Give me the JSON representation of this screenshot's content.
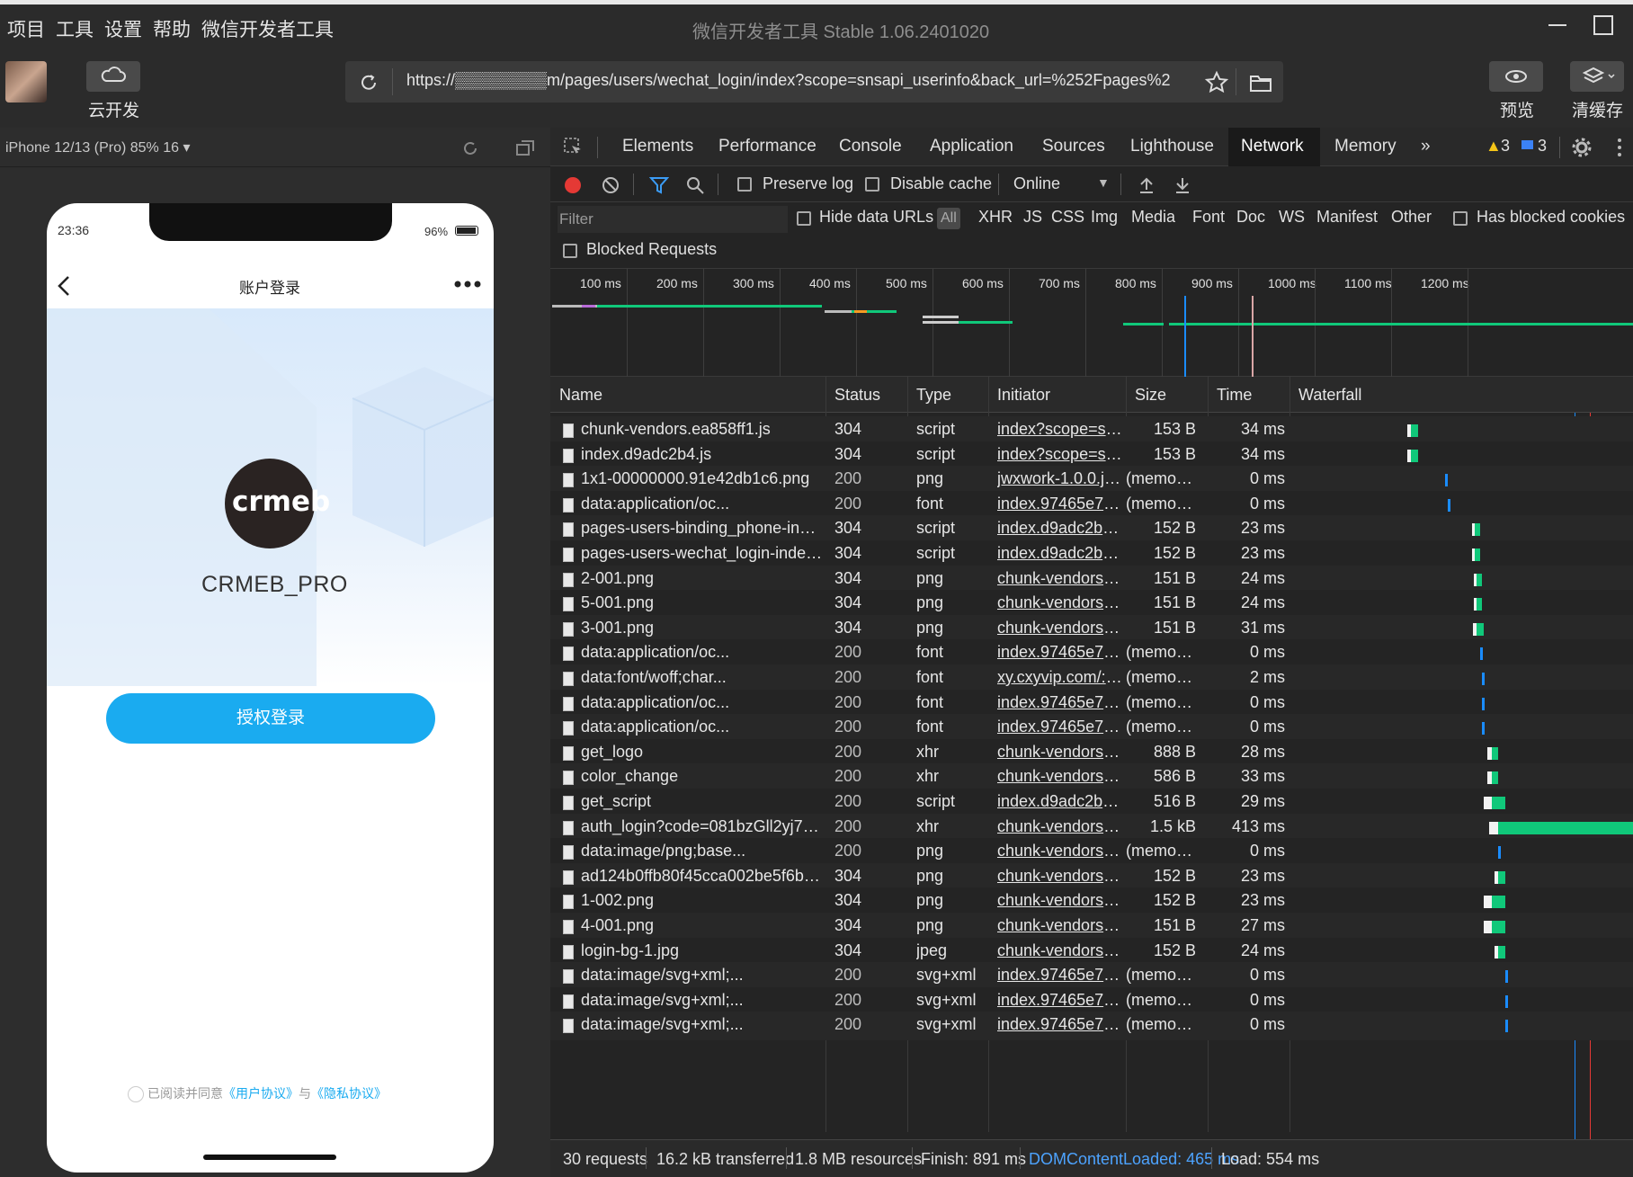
{
  "menu": {
    "items": [
      "项目",
      "工具",
      "设置",
      "帮助",
      "微信开发者工具"
    ],
    "window_title": "微信开发者工具 Stable 1.06.2401020"
  },
  "toolbar": {
    "cloud_label": "云开发",
    "url": "https://▒▒▒▒▒▒▒▒m/pages/users/wechat_login/index?scope=snsapi_userinfo&back_url=%252Fpages%2",
    "preview_label": "预览",
    "clear_cache_label": "清缓存"
  },
  "simulator": {
    "device": "iPhone 12/13 (Pro) 85% 16 ▾",
    "time": "23:36",
    "battery": "96%",
    "nav_title": "账户登录",
    "brand": "CRMEB_PRO",
    "logo_text": "crmeb",
    "login_button": "授权登录",
    "agreement_prefix": "已阅读并同意",
    "user_agreement": "《用户协议》",
    "and": "与",
    "privacy_agreement": "《隐私协议》"
  },
  "devtools": {
    "tabs": [
      "Elements",
      "Performance",
      "Console",
      "Application",
      "Sources",
      "Lighthouse",
      "Network",
      "Memory"
    ],
    "active_tab": "Network",
    "more": "»",
    "warnings": "3",
    "messages": "3",
    "preserve_log": "Preserve log",
    "disable_cache": "Disable cache",
    "throttle": "Online",
    "filter_placeholder": "Filter",
    "hide_data_urls": "Hide data URLs",
    "type_filters": [
      "All",
      "XHR",
      "JS",
      "CSS",
      "Img",
      "Media",
      "Font",
      "Doc",
      "WS",
      "Manifest",
      "Other"
    ],
    "has_blocked_cookies": "Has blocked cookies",
    "blocked_requests": "Blocked Requests",
    "timeline_ticks": [
      "100 ms",
      "200 ms",
      "300 ms",
      "400 ms",
      "500 ms",
      "600 ms",
      "700 ms",
      "800 ms",
      "900 ms",
      "1000 ms",
      "1100 ms",
      "1200 ms"
    ]
  },
  "table": {
    "columns": [
      "Name",
      "Status",
      "Type",
      "Initiator",
      "Size",
      "Time",
      "Waterfall"
    ],
    "rows": [
      {
        "name": "chunk-vendors.ea858ff1.js",
        "status": "304",
        "type": "script",
        "initiator": "index?scope=snsa...",
        "size": "153 B",
        "time": "34 ms",
        "wf": [
          0.34,
          0.02
        ]
      },
      {
        "name": "index.d9adc2b4.js",
        "status": "304",
        "type": "script",
        "initiator": "index?scope=snsa...",
        "size": "153 B",
        "time": "34 ms",
        "wf": [
          0.34,
          0.02
        ]
      },
      {
        "name": "1x1-00000000.91e42db1c6.png",
        "status": "200",
        "type": "png",
        "initiator": "jwxwork-1.0.0.js:1",
        "size": "(memory ...",
        "time": "0 ms",
        "wf": [
          0.44,
          0.004
        ]
      },
      {
        "name": "data:application/oc...",
        "status": "200",
        "type": "font",
        "initiator": "index.97465e7b.css",
        "size": "(memory ...",
        "time": "0 ms",
        "wf": [
          0.45,
          0.004
        ]
      },
      {
        "name": "pages-users-binding_phone-index~p...",
        "status": "304",
        "type": "script",
        "initiator": "index.d9adc2b4.js:1",
        "size": "152 B",
        "time": "23 ms",
        "wf": [
          0.53,
          0.015
        ]
      },
      {
        "name": "pages-users-wechat_login-index.362...",
        "status": "304",
        "type": "script",
        "initiator": "index.d9adc2b4.js:1",
        "size": "152 B",
        "time": "23 ms",
        "wf": [
          0.53,
          0.015
        ]
      },
      {
        "name": "2-001.png",
        "status": "304",
        "type": "png",
        "initiator": "chunk-vendors.ea...",
        "size": "151 B",
        "time": "24 ms",
        "wf": [
          0.535,
          0.015
        ]
      },
      {
        "name": "5-001.png",
        "status": "304",
        "type": "png",
        "initiator": "chunk-vendors.ea...",
        "size": "151 B",
        "time": "24 ms",
        "wf": [
          0.535,
          0.015
        ]
      },
      {
        "name": "3-001.png",
        "status": "304",
        "type": "png",
        "initiator": "chunk-vendors.ea...",
        "size": "151 B",
        "time": "31 ms",
        "wf": [
          0.535,
          0.02
        ]
      },
      {
        "name": "data:application/oc...",
        "status": "200",
        "type": "font",
        "initiator": "index.97465e7b.css",
        "size": "(memory ...",
        "time": "0 ms",
        "wf": [
          0.545,
          0.004
        ]
      },
      {
        "name": "data:font/woff;char...",
        "status": "200",
        "type": "font",
        "initiator": "xy.cxyvip.com/:-Inf...",
        "size": "(memory ...",
        "time": "2 ms",
        "wf": [
          0.55,
          0.004
        ]
      },
      {
        "name": "data:application/oc...",
        "status": "200",
        "type": "font",
        "initiator": "index.97465e7b.css",
        "size": "(memory ...",
        "time": "0 ms",
        "wf": [
          0.55,
          0.004
        ]
      },
      {
        "name": "data:application/oc...",
        "status": "200",
        "type": "font",
        "initiator": "index.97465e7b.css",
        "size": "(memory ...",
        "time": "0 ms",
        "wf": [
          0.55,
          0.004
        ]
      },
      {
        "name": "get_logo",
        "status": "200",
        "type": "xhr",
        "initiator": "chunk-vendors.ea...",
        "size": "888 B",
        "time": "28 ms",
        "wf": [
          0.58,
          0.02
        ]
      },
      {
        "name": "color_change",
        "status": "200",
        "type": "xhr",
        "initiator": "chunk-vendors.ea...",
        "size": "586 B",
        "time": "33 ms",
        "wf": [
          0.58,
          0.02
        ]
      },
      {
        "name": "get_script",
        "status": "200",
        "type": "script",
        "initiator": "index.d9adc2b4.js:1",
        "size": "516 B",
        "time": "29 ms",
        "wf": [
          0.58,
          0.04
        ]
      },
      {
        "name": "auth_login?code=081bzGll2yj7Lc46k...",
        "status": "200",
        "type": "xhr",
        "initiator": "chunk-vendors.ea...",
        "size": "1.5 kB",
        "time": "413 ms",
        "wf": [
          0.6,
          0.4
        ]
      },
      {
        "name": "data:image/png;base...",
        "status": "200",
        "type": "png",
        "initiator": "chunk-vendors.ea...",
        "size": "(memory ...",
        "time": "0 ms",
        "wf": [
          0.6,
          0.004
        ]
      },
      {
        "name": "ad124b0ffb80f45cca002be5f6bdd9aa...",
        "status": "304",
        "type": "png",
        "initiator": "chunk-vendors.ea...",
        "size": "152 B",
        "time": "23 ms",
        "wf": [
          0.6,
          0.02
        ]
      },
      {
        "name": "1-002.png",
        "status": "304",
        "type": "png",
        "initiator": "chunk-vendors.ea...",
        "size": "152 B",
        "time": "23 ms",
        "wf": [
          0.58,
          0.04
        ]
      },
      {
        "name": "4-001.png",
        "status": "304",
        "type": "png",
        "initiator": "chunk-vendors.ea...",
        "size": "151 B",
        "time": "27 ms",
        "wf": [
          0.58,
          0.04
        ]
      },
      {
        "name": "login-bg-1.jpg",
        "status": "304",
        "type": "jpeg",
        "initiator": "chunk-vendors.ea...",
        "size": "152 B",
        "time": "24 ms",
        "wf": [
          0.6,
          0.02
        ]
      },
      {
        "name": "data:image/svg+xml;...",
        "status": "200",
        "type": "svg+xml",
        "initiator": "index.97465e7b.css",
        "size": "(memory ...",
        "time": "0 ms",
        "wf": [
          0.62,
          0.004
        ]
      },
      {
        "name": "data:image/svg+xml;...",
        "status": "200",
        "type": "svg+xml",
        "initiator": "index.97465e7b.css",
        "size": "(memory ...",
        "time": "0 ms",
        "wf": [
          0.62,
          0.004
        ]
      },
      {
        "name": "data:image/svg+xml;...",
        "status": "200",
        "type": "svg+xml",
        "initiator": "index.97465e7b.css",
        "size": "(memory ...",
        "time": "0 ms",
        "wf": [
          0.62,
          0.004
        ]
      }
    ]
  },
  "status": {
    "requests": "30 requests",
    "transferred": "16.2 kB transferred",
    "resources": "1.8 MB resources",
    "finish": "Finish: 891 ms",
    "dcl": "DOMContentLoaded: 465 ms",
    "load": "Load: 554 ms"
  },
  "colors": {
    "accent": "#1aabf0",
    "record": "#e53935",
    "dcl": "#1a8cff",
    "load": "#e53935",
    "wf_green": "#10c87a"
  }
}
